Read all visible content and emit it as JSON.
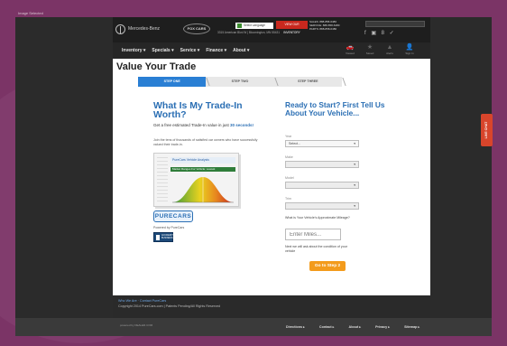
{
  "window": {
    "caption": "Image Selected"
  },
  "header": {
    "brand": "Mercedes-Benz",
    "dealer": "FOX CARS",
    "address": "3315 American Blvd W | Bloomington, MN 55431",
    "language": "Select Language",
    "red_button": "VIEW OUR INVENTORY",
    "contact": {
      "line1": "SALES: 888-858-6480",
      "line2": "SERVICE: 888-858-6480",
      "line3": "PARTS: 888-858-6480"
    },
    "social": "f ▣ 8 ✓"
  },
  "nav": {
    "items": [
      "Inventory ▾",
      "Specials ▾",
      "Service ▾",
      "Finance ▾",
      "About ▾"
    ],
    "icons": [
      {
        "label": "Viewed",
        "icon": "car-icon",
        "glyph": "🚗"
      },
      {
        "label": "Saved",
        "icon": "star-icon",
        "glyph": "★"
      },
      {
        "label": "Alerts",
        "icon": "bell-icon",
        "glyph": "▲"
      },
      {
        "label": "Sign In",
        "icon": "user-icon",
        "glyph": "👤"
      }
    ]
  },
  "main": {
    "page_title": "Value Your Trade",
    "steps": [
      "STEP ONE",
      "STEP TWO",
      "STEP THREE"
    ],
    "left": {
      "title": "What Is My Trade-In Worth?",
      "subtitle_a": "Get a free estimated Trade-In value in just ",
      "subtitle_b": "30 seconds!",
      "desc": "Join the tens of thousands of satisfied car owners who have successfully valued their trade-in.",
      "report_head": "PureCars Vehicle Analysis",
      "report_green": "Market Ranges For Vehicle: Lowest",
      "logo": "PURECARS",
      "powered": "Powered by PureCars",
      "bbb": "ACCREDITED BUSINESS"
    },
    "right": {
      "title": "Ready to Start? First Tell Us About Your Vehicle...",
      "year_label": "Year",
      "year_value": "Select...",
      "make_label": "Make",
      "model_label": "Model",
      "trim_label": "Trim",
      "mileage_question": "What is Your Vehicle's Approximate Mileage?",
      "mileage_placeholder": "Enter Miles...",
      "condition_note": "Next we will ask about the condition of your vehicle",
      "go_button": "Go to Step 2"
    }
  },
  "footer": {
    "links": "Who We Are · Contact PureCars",
    "copyright": "Copyright 2014 PureCars.com | Patents Pending/All Rights Reserved",
    "brand": "powered by DEALER.COM",
    "nav": [
      "Directions ▸",
      "Contact ▸",
      "About ▸",
      "Privacy ▸",
      "Sitemap ▸"
    ]
  },
  "livechat": "LIVE CHAT",
  "colors": {
    "accent": "#2b6fb4",
    "cta": "#f39b1c",
    "alert": "#c8281e"
  }
}
